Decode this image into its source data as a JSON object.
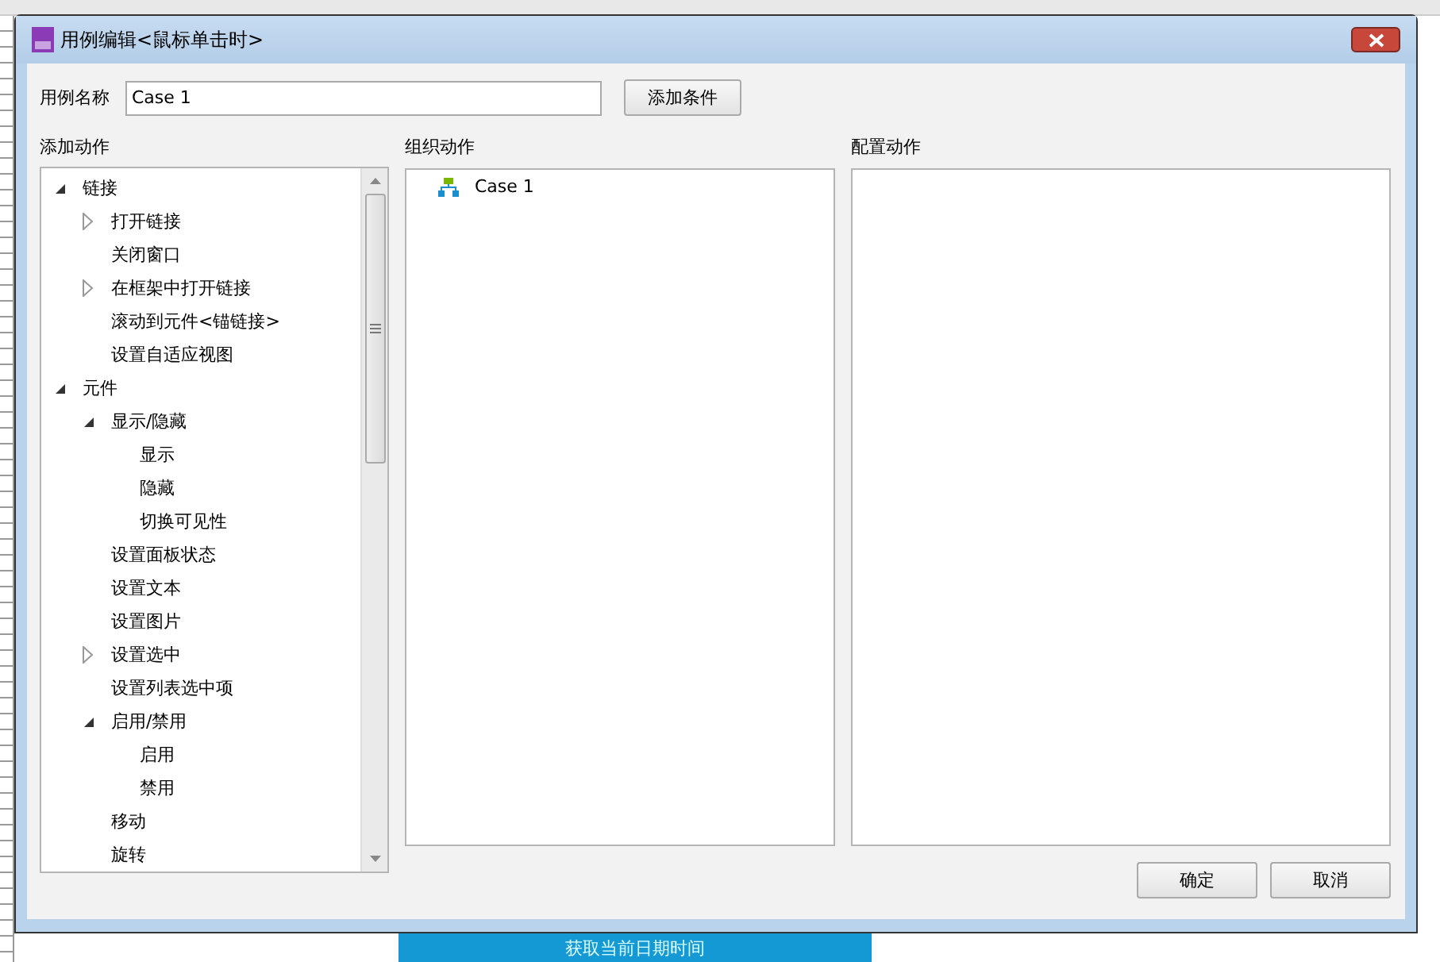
{
  "background_app": {
    "button": {
      "label": "获取当前日期时间"
    }
  },
  "dialog": {
    "title": "用例编辑<鼠标单击时>",
    "case_name": {
      "label": "用例名称",
      "value": "Case 1"
    },
    "add_condition_button": "添加条件",
    "add_actions": {
      "heading": "添加动作",
      "tree": [
        {
          "label": "链接",
          "expanded": true,
          "children": [
            {
              "label": "打开链接",
              "expanded": false
            },
            {
              "label": "关闭窗口"
            },
            {
              "label": "在框架中打开链接",
              "expanded": false
            },
            {
              "label": "滚动到元件<锚链接>"
            },
            {
              "label": "设置自适应视图"
            }
          ]
        },
        {
          "label": "元件",
          "expanded": true,
          "children": [
            {
              "label": "显示/隐藏",
              "expanded": true,
              "children": [
                {
                  "label": "显示"
                },
                {
                  "label": "隐藏"
                },
                {
                  "label": "切换可见性"
                }
              ]
            },
            {
              "label": "设置面板状态"
            },
            {
              "label": "设置文本"
            },
            {
              "label": "设置图片"
            },
            {
              "label": "设置选中",
              "expanded": false
            },
            {
              "label": "设置列表选中项"
            },
            {
              "label": "启用/禁用",
              "expanded": true,
              "children": [
                {
                  "label": "启用"
                },
                {
                  "label": "禁用"
                }
              ]
            },
            {
              "label": "移动"
            },
            {
              "label": "旋转"
            }
          ]
        }
      ]
    },
    "organize_actions": {
      "heading": "组织动作",
      "items": [
        {
          "label": "Case 1"
        }
      ]
    },
    "configure_actions": {
      "heading": "配置动作"
    },
    "buttons": [
      "确定",
      "取消"
    ]
  }
}
